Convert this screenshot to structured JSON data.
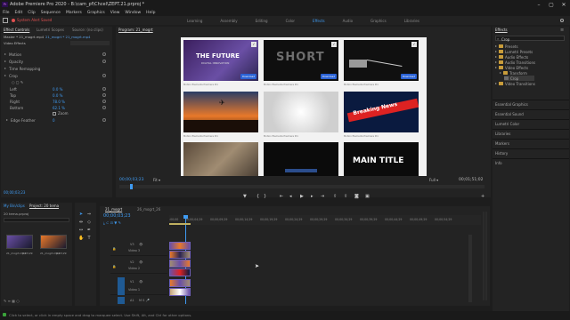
{
  "window": {
    "title": "Adobe Premiere Pro 2020 - B:\\cam_pf\\Chcel\\ZEPT.21.prproj *",
    "minimize": "–",
    "maximize": "▢",
    "close": "✕"
  },
  "menu": [
    "File",
    "Edit",
    "Clip",
    "Sequence",
    "Markers",
    "Graphics",
    "View",
    "Window",
    "Help"
  ],
  "alert": "System Alert Saved",
  "workspaces": [
    {
      "label": "Learning",
      "active": false
    },
    {
      "label": "Assembly",
      "active": false
    },
    {
      "label": "Editing",
      "active": false
    },
    {
      "label": "Color",
      "active": false
    },
    {
      "label": "Effects",
      "active": true
    },
    {
      "label": "Audio",
      "active": false
    },
    {
      "label": "Graphics",
      "active": false
    },
    {
      "label": "Libraries",
      "active": false
    }
  ],
  "left_panel": {
    "tabs": [
      "Effect Controls",
      "Lumetri Scopes",
      "Source: (no clips)"
    ],
    "source_line": "Master * 21_mogrt.mp4",
    "seq_line": "21_mogrt * 21_mogrt.mp4",
    "rows": [
      {
        "label": "Motion"
      },
      {
        "label": "Opacity"
      },
      {
        "label": "Time Remapping"
      },
      {
        "label": "Crop"
      },
      {
        "label": "Left",
        "value": "0.0 %"
      },
      {
        "label": "Top",
        "value": "0.0 %"
      },
      {
        "label": "Right",
        "value": "78.0 %"
      },
      {
        "label": "Bottom",
        "value": "62.1 %"
      },
      {
        "label": "",
        "value": "Zoom"
      },
      {
        "label": "Edge Feather",
        "value": "0"
      }
    ],
    "timecode": "00;00;03;23"
  },
  "program": {
    "tab": "Program: 21_mogrt",
    "timecode": "00;00;03;23",
    "fit": "Fit",
    "quality": "Full",
    "duration": "00;01;51;02",
    "thumbs": [
      {
        "title": "THE FUTURE",
        "sub": "DIGITAL INNOVATION",
        "badge": "Download"
      },
      {
        "title": "SHORT",
        "sub": "",
        "badge": "Download"
      },
      {
        "title": "",
        "sub": "",
        "badge": "Download"
      },
      {
        "title": "",
        "sub": "",
        "badge": ""
      },
      {
        "title": "",
        "sub": "",
        "badge": ""
      },
      {
        "title": "Breaking News",
        "sub": "Breaking News",
        "badge": ""
      },
      {
        "title": "",
        "sub": "",
        "badge": ""
      },
      {
        "title": "",
        "sub": "",
        "badge": ""
      },
      {
        "title": "MAIN TITLE",
        "sub": "",
        "badge": ""
      }
    ],
    "caption": "Motion Elements Premiere Pro"
  },
  "effects": {
    "tab": "Effects",
    "search": "Crop",
    "tree": [
      {
        "label": "Presets",
        "type": "folder"
      },
      {
        "label": "Lumetri Presets",
        "type": "folder"
      },
      {
        "label": "Audio Effects",
        "type": "folder"
      },
      {
        "label": "Audio Transitions",
        "type": "folder"
      },
      {
        "label": "Video Effects",
        "type": "folder"
      },
      {
        "label": "Transform",
        "type": "folder"
      },
      {
        "label": "Crop",
        "type": "item"
      },
      {
        "label": "Video Transitions",
        "type": "folder"
      }
    ],
    "sections": [
      "Essential Graphics",
      "Essential Sound",
      "Lumetri Color",
      "Libraries",
      "Markers",
      "History",
      "Info"
    ]
  },
  "project": {
    "tabs": [
      "My Bin/clips",
      "Project: 20 tema"
    ],
    "path": "20 tema.prproj",
    "items": [
      {
        "name": "21_mogrt.mp4",
        "dur": "8;03;29"
      },
      {
        "name": "21_mogrt.mp4",
        "dur": "8;03;29"
      }
    ],
    "count": "2 Items"
  },
  "timeline": {
    "tabs": [
      "21_mogrt",
      "26_mogrt_26"
    ],
    "timecode": "00;00;03;23",
    "ruler": [
      ":00;00",
      "00;00;04;29",
      "00;00;09;29",
      "00;00;14;29",
      "00;00;19;29",
      "00;00;24;29",
      "00;00;29;29",
      "00;00;34;29",
      "00;00;39;29",
      "00;00;44;29",
      "00;00;49;29",
      "00;00;54;29"
    ],
    "tracks": [
      {
        "name": "V3",
        "label": "Video 3"
      },
      {
        "name": "V2",
        "label": "Video 2"
      },
      {
        "name": "V1",
        "label": "Video 1"
      },
      {
        "name": "A1",
        "label": ""
      }
    ]
  },
  "status": "Click to select, or click in empty space and drag to marquee select. Use Shift, Alt, and Ctrl for other options."
}
